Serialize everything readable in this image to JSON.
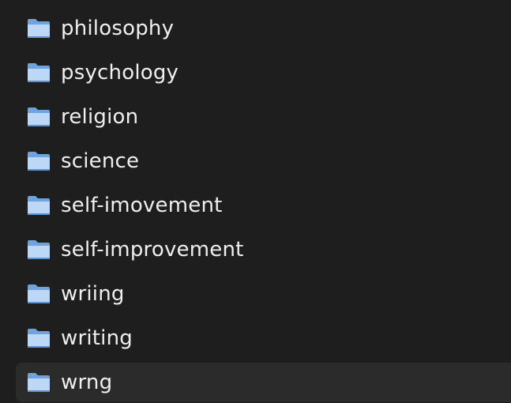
{
  "folders": [
    {
      "name": "philosophy",
      "icon": "folder-icon"
    },
    {
      "name": "psychology",
      "icon": "folder-icon"
    },
    {
      "name": "religion",
      "icon": "folder-icon"
    },
    {
      "name": "science",
      "icon": "folder-icon"
    },
    {
      "name": "self-imovement",
      "icon": "folder-icon"
    },
    {
      "name": "self-improvement",
      "icon": "folder-icon"
    },
    {
      "name": "wriing",
      "icon": "folder-icon"
    },
    {
      "name": "writing",
      "icon": "folder-icon"
    },
    {
      "name": "wrng",
      "icon": "folder-icon"
    }
  ],
  "colors": {
    "background": "#1e1e1e",
    "hover_row": "#2b2b2b",
    "text": "#efefef",
    "folder_body": "#7fb0e6",
    "folder_front": "#c3dcf7"
  }
}
